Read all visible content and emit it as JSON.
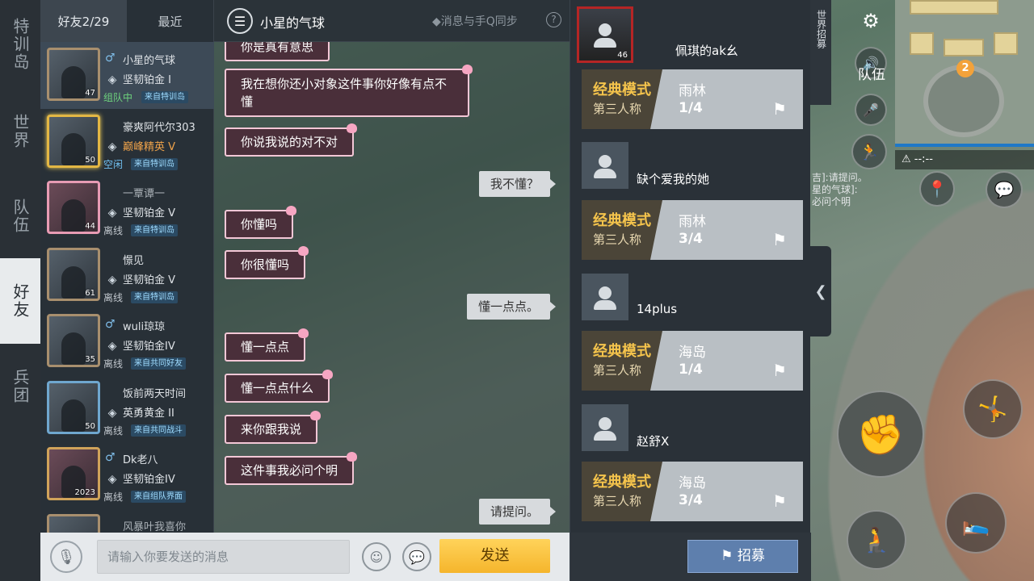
{
  "left_nav": [
    {
      "label": "特训岛",
      "active": false
    },
    {
      "label": "世界",
      "active": false
    },
    {
      "label": "队伍",
      "active": false
    },
    {
      "label": "好友",
      "active": true
    },
    {
      "label": "兵团",
      "active": false
    }
  ],
  "friend_tabs": [
    {
      "label": "好友2/29",
      "active": true
    },
    {
      "label": "最近",
      "active": false
    }
  ],
  "friends": [
    {
      "name": "小星的气球",
      "gender": "♂",
      "rank": "坚韧铂金 I",
      "level": "47",
      "status": "组队中",
      "source": "来自特训岛",
      "selected": true
    },
    {
      "name": "豪爽阿代尔303",
      "gender": "",
      "rank": "巅峰精英 V",
      "level": "50",
      "status": "空闲",
      "source": "来自特训岛"
    },
    {
      "name": "一覃谭一",
      "gender": "",
      "rank": "坚韧铂金 V",
      "level": "44",
      "status": "离线",
      "source": "来自特训岛"
    },
    {
      "name": "憬见",
      "gender": "",
      "rank": "坚韧铂金 V",
      "level": "61",
      "status": "离线",
      "source": "来自特训岛"
    },
    {
      "name": "wuli琼琼",
      "gender": "♂",
      "rank": "坚韧铂金IV",
      "level": "35",
      "status": "离线",
      "source": "来自共同好友"
    },
    {
      "name": "饭前两天时间",
      "gender": "",
      "rank": "英勇黄金 II",
      "level": "50",
      "status": "离线",
      "source": "来自共同战斗"
    },
    {
      "name": "Dk老八",
      "gender": "♂",
      "rank": "坚韧铂金IV",
      "level": "2023",
      "status": "离线",
      "source": "来自组队界面"
    },
    {
      "name": "风暴叶我喜你",
      "gender": "",
      "rank": "",
      "level": "",
      "status": "",
      "source": ""
    }
  ],
  "chat": {
    "title": "小星的气球",
    "sync_label": "◆消息与手Q同步",
    "help": "?",
    "messages": [
      {
        "dir": "in",
        "text": "你是真有意思"
      },
      {
        "dir": "in",
        "text": "我在想你还小对象这件事你好像有点不懂"
      },
      {
        "dir": "in",
        "text": "你说我说的对不对"
      },
      {
        "dir": "out",
        "text": "我不懂？"
      },
      {
        "dir": "in",
        "text": "你懂吗"
      },
      {
        "dir": "in",
        "text": "你很懂吗"
      },
      {
        "dir": "out",
        "text": "懂一点点。"
      },
      {
        "dir": "in",
        "text": "懂一点点"
      },
      {
        "dir": "in",
        "text": "懂一点点什么"
      },
      {
        "dir": "in",
        "text": "来你跟我说"
      },
      {
        "dir": "in",
        "text": "这件事我必问个明"
      },
      {
        "dir": "out",
        "text": "请提问。"
      }
    ]
  },
  "input": {
    "placeholder": "请输入你要发送的消息",
    "send_label": "发送"
  },
  "recruit": {
    "players": [
      {
        "name": "佩琪的ak幺",
        "level": "46",
        "mode": "经典模式",
        "view": "第三人称",
        "map": "雨林",
        "slots": "1/4"
      },
      {
        "name": "缺个爱我的她",
        "level": "",
        "mode": "经典模式",
        "view": "第三人称",
        "map": "雨林",
        "slots": "3/4"
      },
      {
        "name": "14plus",
        "level": "",
        "mode": "经典模式",
        "view": "第三人称",
        "map": "海岛",
        "slots": "1/4"
      },
      {
        "name": "赵舒X",
        "level": "",
        "mode": "经典模式",
        "view": "第三人称",
        "map": "海岛",
        "slots": "3/4"
      }
    ],
    "recruit_button": "招募",
    "collapse_icon": "chevron-left-icon"
  },
  "hud": {
    "side_menu": "世界招募",
    "team_label": "队伍",
    "map_marker": "2",
    "timer": "--:--",
    "kill_feed": [
      "吉]:请提问。",
      "星的气球]:",
      "必问个明"
    ]
  },
  "colors": {
    "send_button": "#f5b52c",
    "recruit_button": "#5e7fad",
    "mode_gold": "#f5c44c",
    "chat_bubble_border": "#f3c7d6"
  }
}
